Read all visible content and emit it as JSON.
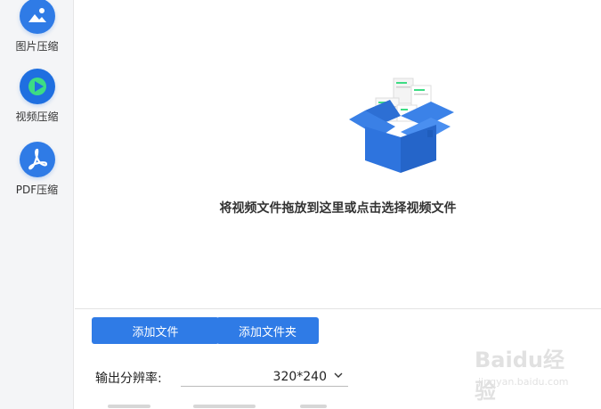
{
  "sidebar": {
    "items": [
      {
        "label": "图片压缩",
        "icon": "image-icon"
      },
      {
        "label": "视频压缩",
        "icon": "play-icon"
      },
      {
        "label": "PDF压缩",
        "icon": "pdf-icon"
      }
    ]
  },
  "main": {
    "drop_text": "将视频文件拖放到这里或点击选择视频文件"
  },
  "toolbar": {
    "add_file_label": "添加文件",
    "add_folder_label": "添加文件夹"
  },
  "settings": {
    "resolution_label": "输出分辨率:",
    "resolution_value": "320*240"
  },
  "watermark": {
    "logo_text": "Baidu经验",
    "sub_text": "jingyan.baidu.com"
  },
  "colors": {
    "accent": "#2f7be6",
    "play_green": "#3ddc84"
  }
}
